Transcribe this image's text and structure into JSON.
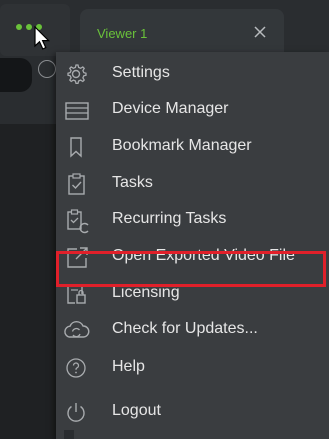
{
  "app": {
    "tab_label": "Viewer 1",
    "accent_color": "#6ac23a",
    "highlight_color": "#e0202a"
  },
  "icons": {
    "app_menu": "three-dots-icon",
    "tab_close": "close-icon",
    "cursor": "mouse-cursor-icon"
  },
  "menu": {
    "items": [
      {
        "label": "Settings",
        "icon": "gear-icon"
      },
      {
        "label": "Device Manager",
        "icon": "device-list-icon"
      },
      {
        "label": "Bookmark Manager",
        "icon": "bookmark-icon"
      },
      {
        "label": "Tasks",
        "icon": "clipboard-check-icon"
      },
      {
        "label": "Recurring Tasks",
        "icon": "recurring-tasks-icon"
      },
      {
        "label": "Open Exported Video File",
        "icon": "open-external-icon"
      },
      {
        "label": "Licensing",
        "icon": "license-icon",
        "highlighted": true
      },
      {
        "label": "Check for Updates...",
        "icon": "cloud-sync-icon"
      },
      {
        "label": "Help",
        "icon": "help-icon"
      },
      {
        "label": "Logout",
        "icon": "power-icon"
      }
    ]
  }
}
